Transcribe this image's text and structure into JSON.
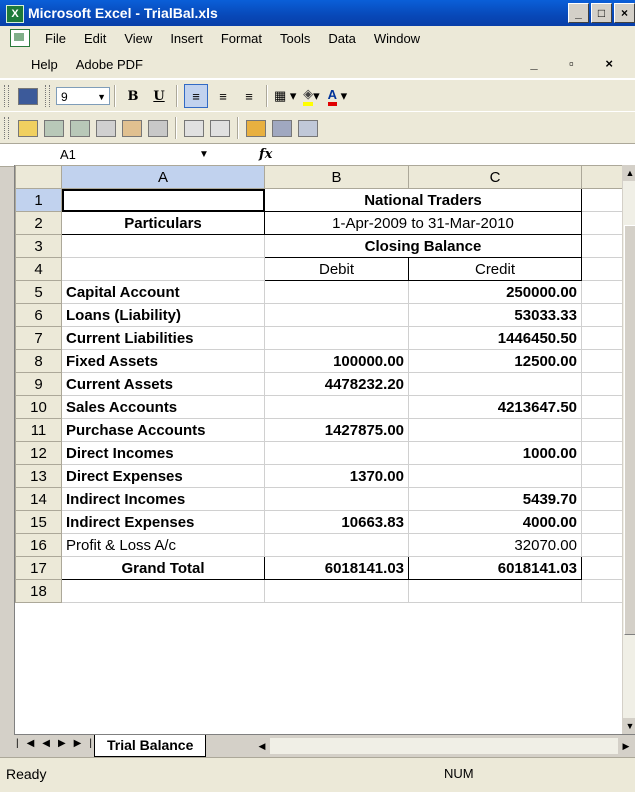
{
  "window": {
    "title": "Microsoft Excel - TrialBal.xls",
    "controls": [
      "_",
      "□",
      "×"
    ]
  },
  "menu": {
    "row1": [
      "File",
      "Edit",
      "View",
      "Insert",
      "Format",
      "Tools",
      "Data",
      "Window"
    ],
    "row2": [
      "Help",
      "Adobe PDF"
    ]
  },
  "toolbar": {
    "font_size": "9",
    "bold": "B",
    "underline": "U",
    "font_color_letter": "A"
  },
  "formula_bar": {
    "name_box": "A1",
    "fx": "fx",
    "content": ""
  },
  "sheet": {
    "columns": [
      "A",
      "B",
      "C"
    ],
    "rows": [
      {
        "n": "1",
        "a": "",
        "b": "National Traders",
        "c": ""
      },
      {
        "n": "2",
        "a": "Particulars",
        "b": "1-Apr-2009 to 31-Mar-2010",
        "c": ""
      },
      {
        "n": "3",
        "a": "",
        "b": "Closing Balance",
        "c": ""
      },
      {
        "n": "4",
        "a": "",
        "b": "Debit",
        "c": "Credit"
      },
      {
        "n": "5",
        "a": "Capital Account",
        "b": "",
        "c": "250000.00"
      },
      {
        "n": "6",
        "a": "Loans (Liability)",
        "b": "",
        "c": "53033.33"
      },
      {
        "n": "7",
        "a": "Current Liabilities",
        "b": "",
        "c": "1446450.50"
      },
      {
        "n": "8",
        "a": "Fixed Assets",
        "b": "100000.00",
        "c": "12500.00"
      },
      {
        "n": "9",
        "a": "Current Assets",
        "b": "4478232.20",
        "c": ""
      },
      {
        "n": "10",
        "a": "Sales Accounts",
        "b": "",
        "c": "4213647.50"
      },
      {
        "n": "11",
        "a": "Purchase Accounts",
        "b": "1427875.00",
        "c": ""
      },
      {
        "n": "12",
        "a": "Direct Incomes",
        "b": "",
        "c": "1000.00"
      },
      {
        "n": "13",
        "a": "Direct Expenses",
        "b": "1370.00",
        "c": ""
      },
      {
        "n": "14",
        "a": "Indirect Incomes",
        "b": "",
        "c": "5439.70"
      },
      {
        "n": "15",
        "a": "Indirect Expenses",
        "b": "10663.83",
        "c": "4000.00"
      },
      {
        "n": "16",
        "a": "Profit & Loss A/c",
        "b": "",
        "c": "32070.00"
      },
      {
        "n": "17",
        "a": "Grand Total",
        "b": "6018141.03",
        "c": "6018141.03"
      },
      {
        "n": "18",
        "a": "",
        "b": "",
        "c": ""
      }
    ]
  },
  "tab": {
    "name": "Trial Balance"
  },
  "status": {
    "left": "Ready",
    "num": "NUM"
  }
}
